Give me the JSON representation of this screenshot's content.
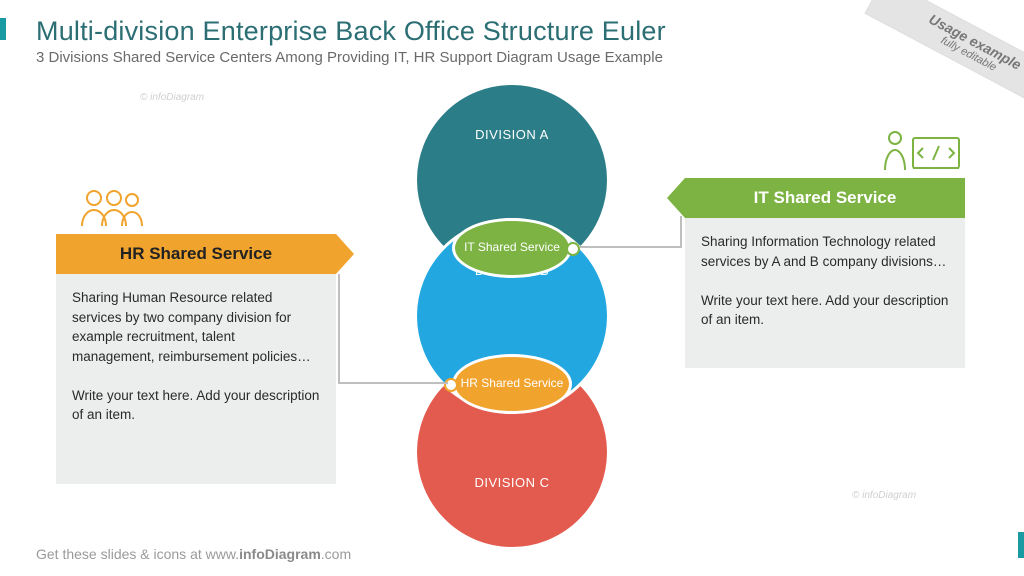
{
  "title": "Multi-division Enterprise Back Office Structure Euler",
  "subtitle": "3 Divisions Shared Service Centers Among Providing IT, HR Support Diagram Usage Example",
  "ribbon": {
    "line1": "Usage example",
    "line2": "fully editable"
  },
  "euler": {
    "divA": "DIVISION A",
    "divB": "DIVISION B",
    "divC": "DIVISION C",
    "lensIT": "IT Shared Service",
    "lensHR": "HR Shared Service"
  },
  "callouts": {
    "hr": {
      "title": "HR Shared Service",
      "body": "Sharing Human Resource related services by two company division for example recruitment, talent management, reimbursement policies…\n\nWrite your text here. Add your description of an item."
    },
    "it": {
      "title": "IT Shared Service",
      "body": "Sharing Information Technology related services by A and B company divisions…\n\nWrite your text here. Add your description of an item."
    }
  },
  "footer": {
    "prefix": "Get these slides & icons at www.",
    "brand": "infoDiagram",
    "suffix": ".com"
  },
  "watermark": "© infoDiagram",
  "colors": {
    "teal": "#2b7d87",
    "blue": "#23a7e0",
    "red": "#e35b4f",
    "green": "#7cb342",
    "orange": "#f0a32d"
  }
}
